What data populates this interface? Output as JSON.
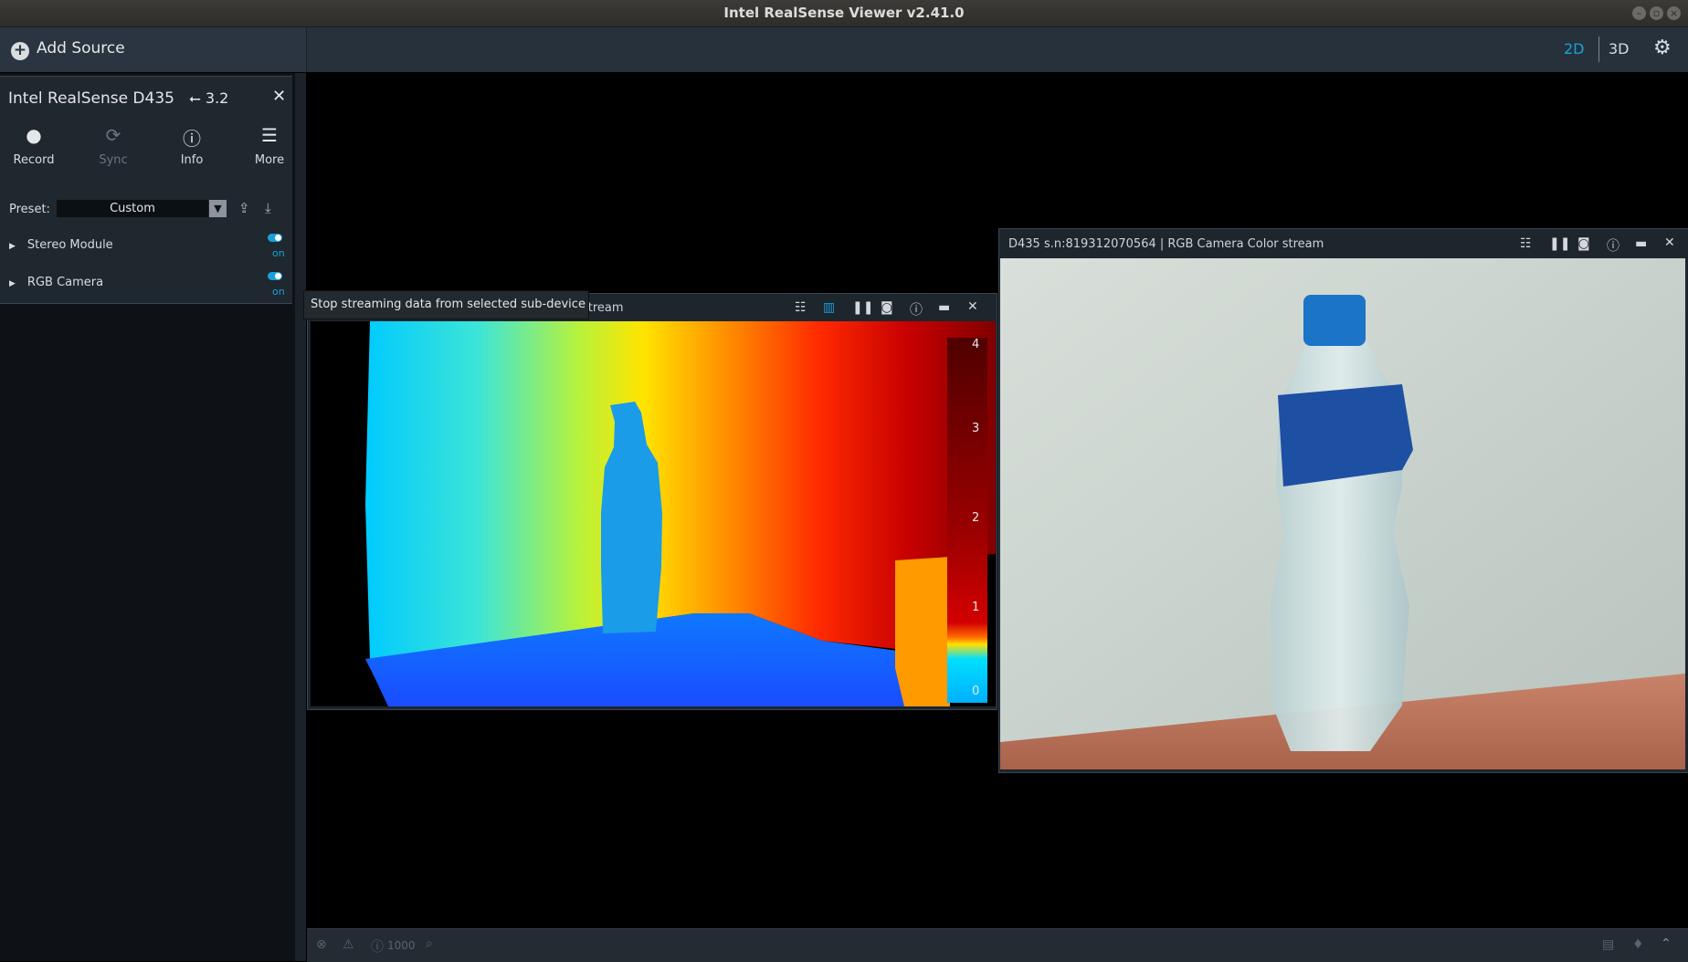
{
  "window": {
    "title": "Intel RealSense Viewer v2.41.0"
  },
  "toolbar": {
    "add_source": "Add Source",
    "view_2d": "2D",
    "view_3d": "3D"
  },
  "device": {
    "name": "Intel RealSense D435",
    "usb_version": "3.2",
    "tools": [
      {
        "label": "Record",
        "icon": "record-icon"
      },
      {
        "label": "Sync",
        "icon": "sync-icon"
      },
      {
        "label": "Info",
        "icon": "info-icon"
      },
      {
        "label": "More",
        "icon": "menu-icon"
      }
    ],
    "preset_label": "Preset:",
    "preset_value": "Custom",
    "modules": [
      {
        "label": "Stereo Module",
        "state": "on"
      },
      {
        "label": "RGB Camera",
        "state": "on"
      }
    ]
  },
  "depth_stream": {
    "title_fragment": "stream",
    "tooltip": "Stop streaming data from selected sub-device",
    "colormap_ticks": [
      "4",
      "3",
      "2",
      "1",
      "0"
    ]
  },
  "rgb_stream": {
    "title": "D435 s.n:819312070564 | RGB Camera Color stream"
  },
  "statusbar": {
    "counter": "1000"
  },
  "colors": {
    "accent": "#1aa0d8",
    "panel": "#1f272f",
    "toolbar": "#2a3541"
  }
}
